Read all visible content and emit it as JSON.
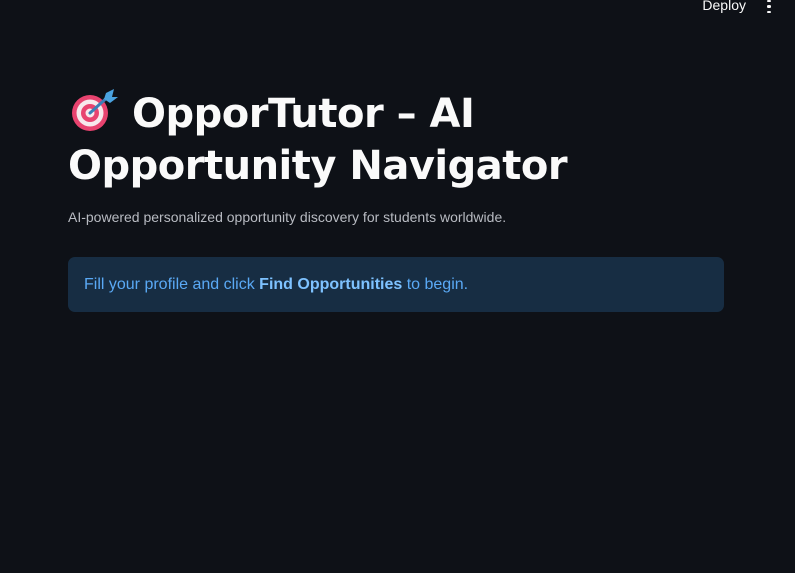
{
  "header": {
    "deploy_label": "Deploy",
    "menu_icon": "vertical-ellipsis-icon"
  },
  "main": {
    "title_icon": "direct-hit-target-emoji",
    "title_text": "OpporTutor – AI Opportunity Navigator",
    "subtitle": "AI-powered personalized opportunity discovery for students worldwide.",
    "info": {
      "prefix": "Fill your profile and click ",
      "emphasis": "Find Opportunities",
      "suffix": " to begin."
    }
  },
  "colors": {
    "background": "#0e1117",
    "info_background": "#172d43",
    "info_text": "#5aa9f5"
  }
}
